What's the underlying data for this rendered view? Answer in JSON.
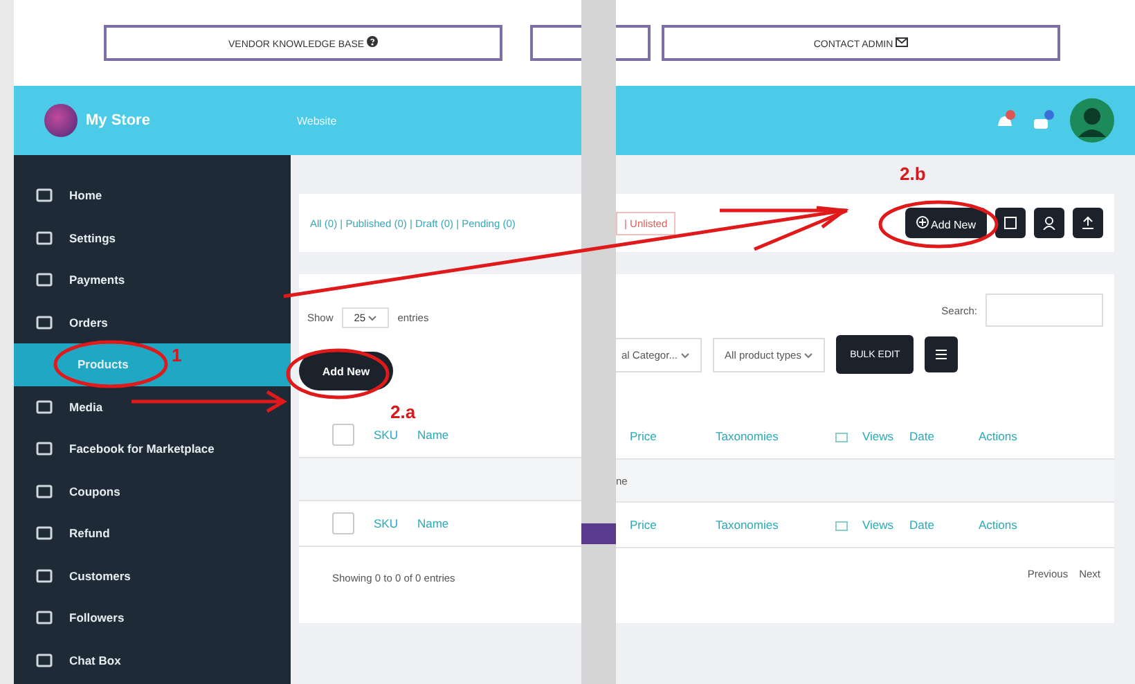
{
  "top_links": [
    {
      "label": "VENDOR KNOWLEDGE BASE"
    },
    {
      "label": "CONTACT ADMIN"
    }
  ],
  "header": {
    "store_name": "My Store",
    "website_link": "Website"
  },
  "sidebar": {
    "items": [
      {
        "label": "Home",
        "selected": false,
        "sub": false
      },
      {
        "label": "Settings",
        "selected": false,
        "sub": false
      },
      {
        "label": "Payments",
        "selected": false,
        "sub": false
      },
      {
        "label": "Orders",
        "selected": false,
        "sub": false
      },
      {
        "label": "Products",
        "selected": true,
        "sub": true
      },
      {
        "label": "Media",
        "selected": false,
        "sub": false
      },
      {
        "label": "Facebook for Marketplace",
        "selected": false,
        "sub": false
      },
      {
        "label": "Coupons",
        "selected": false,
        "sub": false
      },
      {
        "label": "Refund",
        "selected": false,
        "sub": false
      },
      {
        "label": "Customers",
        "selected": false,
        "sub": false
      },
      {
        "label": "Followers",
        "selected": false,
        "sub": false
      },
      {
        "label": "Chat Box",
        "selected": false,
        "sub": false
      }
    ]
  },
  "status_filter_left": "All (0) | Published (0) | Draft (0) | Pending (0)",
  "status_filter_right": "| Unlisted",
  "add_new_left": "Add New",
  "add_new_right": "Add New",
  "show_entries": {
    "prefix": "Show",
    "value": "25",
    "suffix": "entries"
  },
  "search_label": "Search:",
  "category_filter": "al Categor...",
  "type_filter": "All product types",
  "bulk_edit": "BULK EDIT",
  "table": {
    "header_checked": false,
    "row_checked": false,
    "left_columns": [
      "SKU",
      "Name"
    ],
    "right_columns": [
      "Price",
      "Taxonomies",
      "Views",
      "Date",
      "Actions"
    ],
    "empty_fragment": "ne",
    "left_footer": [
      "SKU",
      "Name"
    ],
    "right_footer": [
      "Price",
      "Taxonomies",
      "Views",
      "Date",
      "Actions"
    ]
  },
  "showing": "Showing 0 to 0 of 0 entries",
  "pagination": [
    "Previous",
    "Next"
  ],
  "annotations": [
    "1",
    "2.a",
    "2.b"
  ]
}
